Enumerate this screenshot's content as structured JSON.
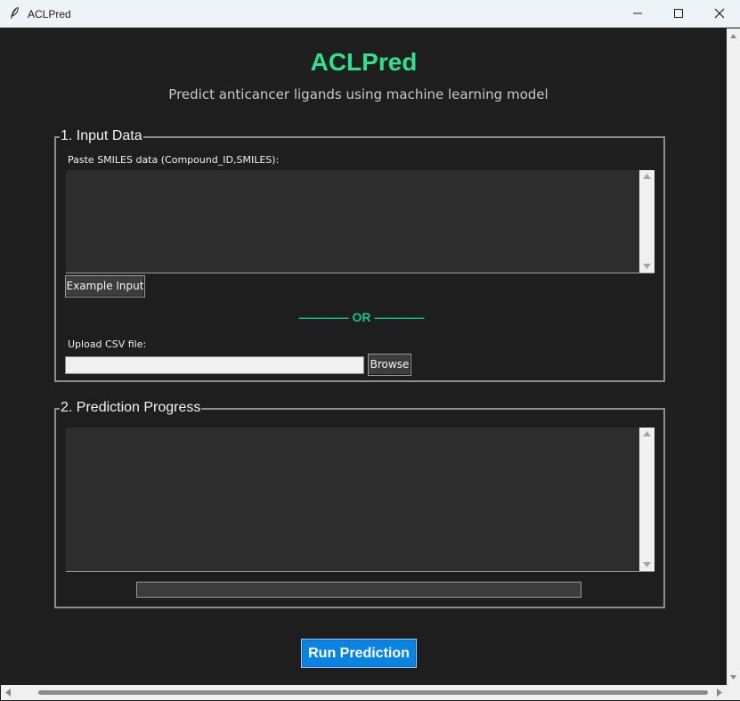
{
  "window": {
    "title": "ACLPred",
    "icon": "feather-icon",
    "controls": [
      "minimize-icon",
      "maximize-icon",
      "close-icon"
    ]
  },
  "header": {
    "title": "ACLPred",
    "subtitle": "Predict anticancer ligands using machine learning model",
    "title_color": "#2fe08c"
  },
  "input_section": {
    "title": "1. Input Data",
    "smiles_label": "Paste SMILES data (Compound_ID,SMILES):",
    "smiles_value": "",
    "example_button": "Example Input",
    "or_divider": "———— OR ————",
    "upload_label": "Upload CSV file:",
    "file_path_value": "",
    "browse_button": "Browse"
  },
  "progress_section": {
    "title": "2. Prediction Progress",
    "log_value": "",
    "progress_fraction": 0
  },
  "actions": {
    "run_button": "Run Prediction",
    "run_button_color": "#0a84e0"
  },
  "colors": {
    "background": "#1e1e1e",
    "text_area": "#2d2d2d",
    "divider_accent": "#16c48d"
  }
}
